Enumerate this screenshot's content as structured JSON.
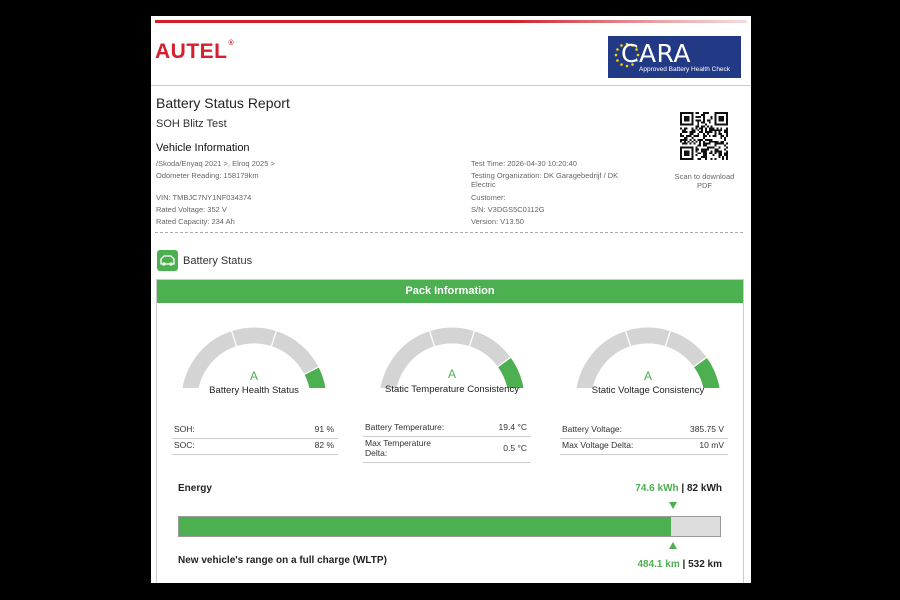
{
  "brand": {
    "autel": "AUTEL",
    "autel_mark": "®",
    "cara_word": "CARA",
    "cara_sub": "Approved Battery Health Check",
    "accent": "#d5202e",
    "cara_bg": "#223a86"
  },
  "report": {
    "title": "Battery Status Report",
    "subtitle": "SOH Blitz Test"
  },
  "vehicle": {
    "heading": "Vehicle Information",
    "model": "/Skoda/Enyaq 2021 >, Elroq 2025 >",
    "odometer": "Odometer Reading: 158179km",
    "vin": "VIN: TMBJC7NY1NF034374",
    "rated_voltage": "Rated Voltage: 352 V",
    "rated_capacity": "Rated Capacity: 234 Ah",
    "test_time": "Test Time: 2026-04-30 10:20:40",
    "org_line1": "Testing Organization: DK Garagebedrijf / DK",
    "org_line2": "Electric",
    "customer": "Customer:",
    "sn": "S/N: V3DGS5C0112G",
    "version": "Version: V13.50"
  },
  "qr": {
    "caption_line1": "Scan to download",
    "caption_line2": "PDF",
    "icon": "qr-code"
  },
  "battery_status": {
    "title": "Battery Status",
    "icon": "battery-icon",
    "color": "#4caf50"
  },
  "pack": {
    "header": "Pack Information",
    "gauges": [
      {
        "grade": "A",
        "label": "Battery Health Status",
        "level": 0.91
      },
      {
        "grade": "A",
        "label": "Static Temperature Consistency",
        "level": 0.8
      },
      {
        "grade": "A",
        "label": "Static Voltage Consistency",
        "level": 0.8
      }
    ],
    "col1": [
      {
        "label": "SOH:",
        "value": "91 %"
      },
      {
        "label": "SOC:",
        "value": "82 %"
      }
    ],
    "col2": [
      {
        "label": "Battery Temperature:",
        "value": "19.4 °C"
      },
      {
        "label": "Max Temperature",
        "label2": "Delta:",
        "value": "0.5 °C"
      }
    ],
    "col3": [
      {
        "label": "Battery Voltage:",
        "value": "385.75 V"
      },
      {
        "label": "Max Voltage Delta:",
        "value": "10 mV"
      }
    ]
  },
  "energy": {
    "label": "Energy",
    "current": "74.6 kWh",
    "sep": " | ",
    "total": "82 kWh",
    "range_label": "New vehicle's range on a full charge (WLTP)",
    "range_current": "484.1 km",
    "range_total": "532 km",
    "fraction": 0.91
  }
}
